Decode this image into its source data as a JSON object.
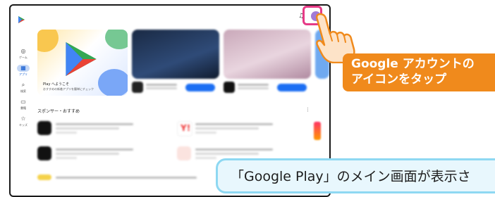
{
  "hero": {
    "title": "Play へようこそ",
    "subtitle": "おすすめの新着アプリを簡単にチェック"
  },
  "rail": [
    {
      "icon": "gamepad-icon",
      "glyph": "◎",
      "label": "ゲーム"
    },
    {
      "icon": "apps-icon",
      "glyph": "▦",
      "label": "アプリ"
    },
    {
      "icon": "search-icon",
      "glyph": "⌕",
      "label": "検索"
    },
    {
      "icon": "book-icon",
      "glyph": "▭",
      "label": "書籍"
    },
    {
      "icon": "kids-icon",
      "glyph": "☆",
      "label": "キッズ"
    }
  ],
  "section": {
    "title": "スポンサー・おすすめ",
    "more": "⋮"
  },
  "topbar": {
    "bell": "♫"
  },
  "annotation": {
    "line1": "Google アカウントの",
    "line2": "アイコンをタップ"
  },
  "caption": {
    "text": "「Google Play」のメイン画面が表示さ"
  },
  "colors": {
    "accent_orange": "#f08a1c",
    "highlight_pink": "#e63a86",
    "caption_border": "#8ed8f2",
    "avatar": "#a27bd6"
  }
}
